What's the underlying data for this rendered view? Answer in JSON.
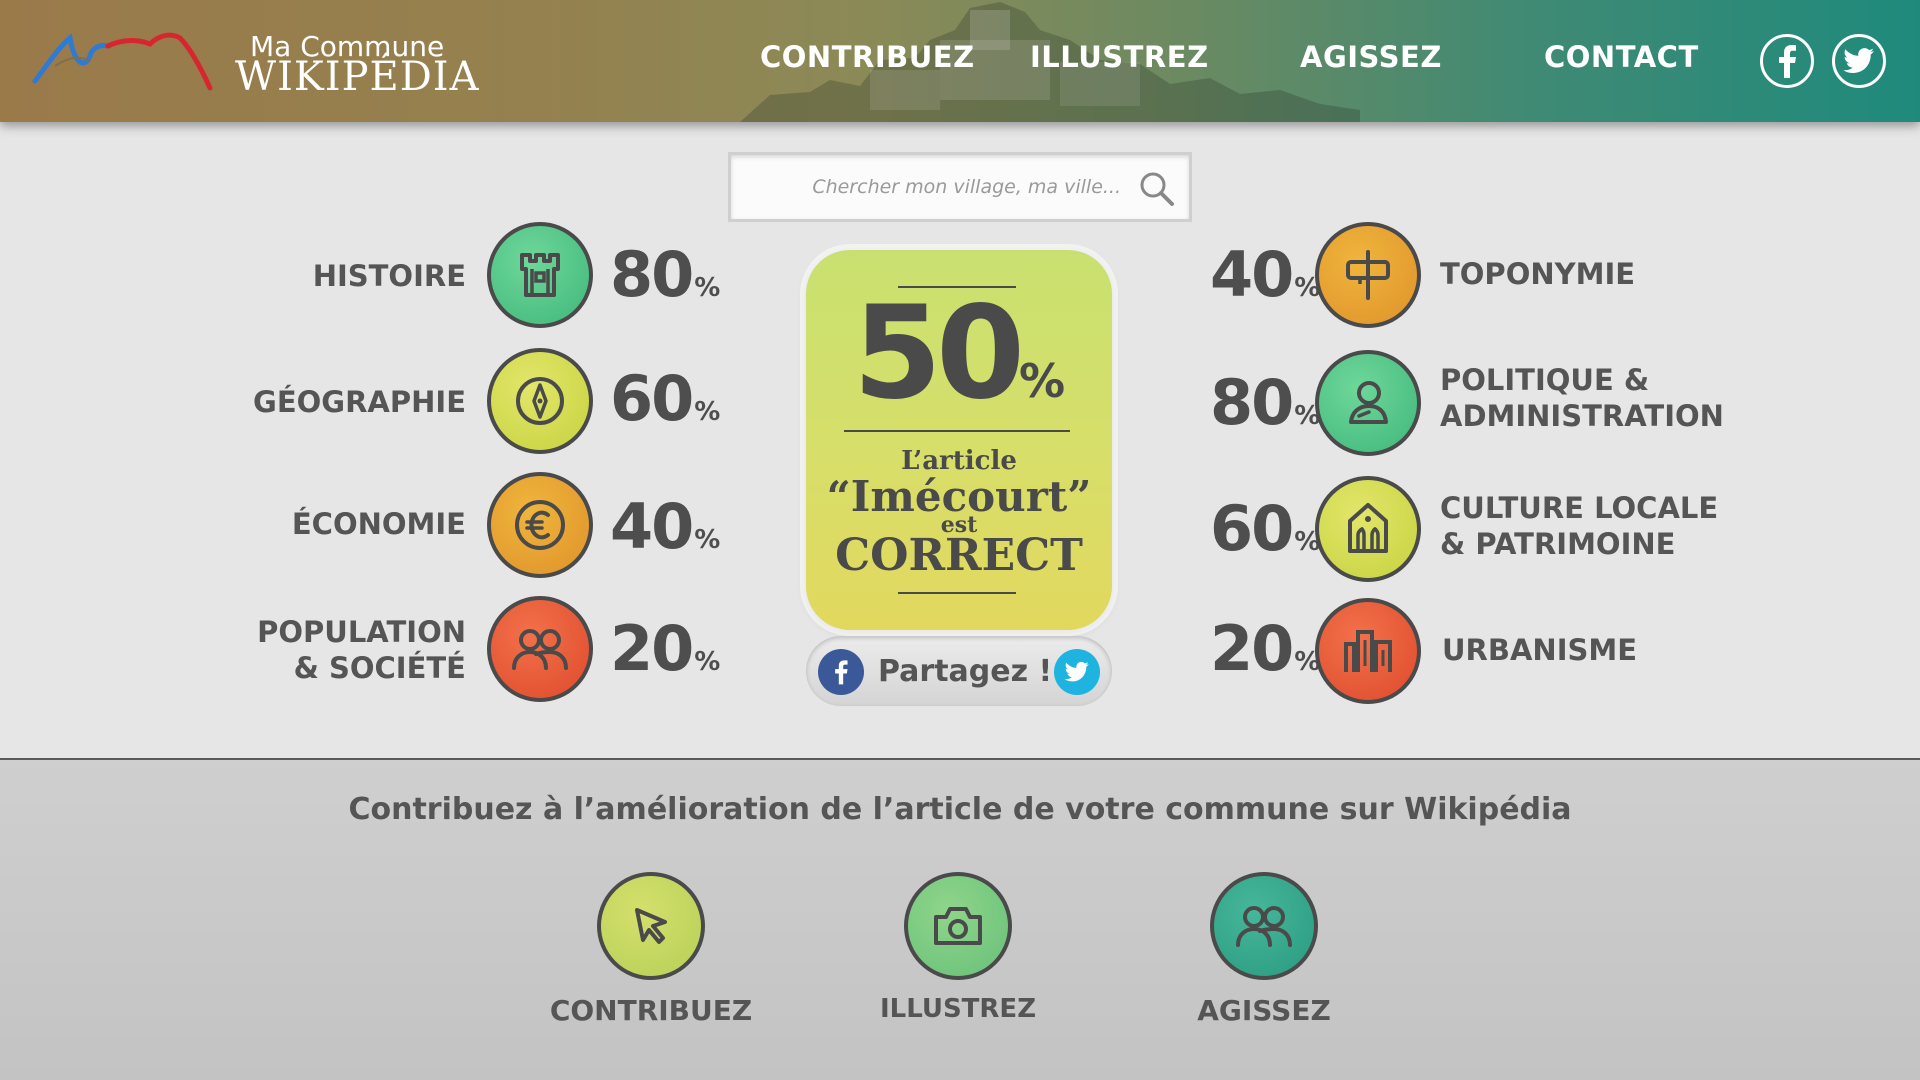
{
  "header": {
    "logo_line1": "Ma Commune",
    "logo_line2": "WIKIPÉDIA",
    "nav": [
      "CONTRIBUEZ",
      "ILLUSTREZ",
      "AGISSEZ",
      "CONTACT"
    ]
  },
  "search": {
    "placeholder": "Chercher mon village, ma ville..."
  },
  "categories_left": [
    {
      "label": "HISTOIRE",
      "value": "80",
      "icon": "castle-icon"
    },
    {
      "label": "GÉOGRAPHIE",
      "value": "60",
      "icon": "compass-icon"
    },
    {
      "label": "ÉCONOMIE",
      "value": "40",
      "icon": "euro-icon"
    },
    {
      "label_lines": [
        "POPULATION",
        "& SOCIÉTÉ"
      ],
      "value": "20",
      "icon": "people-icon"
    }
  ],
  "categories_right": [
    {
      "label": "TOPONYMIE",
      "value": "40",
      "icon": "signpost-icon"
    },
    {
      "label_lines": [
        "POLITIQUE &",
        "ADMINISTRATION"
      ],
      "value": "80",
      "icon": "person-icon"
    },
    {
      "label_lines": [
        "CULTURE LOCALE",
        "& PATRIMOINE"
      ],
      "value": "60",
      "icon": "monument-icon"
    },
    {
      "label": "URBANISME",
      "value": "20",
      "icon": "buildings-icon"
    }
  ],
  "percent_symbol": "%",
  "score": {
    "value": "50",
    "line1": "L’article",
    "line2": "“Imécourt”",
    "line3": "est",
    "line4": "CORRECT"
  },
  "share": {
    "label": "Partagez !"
  },
  "footer": {
    "title": "Contribuez à l’amélioration de l’article de votre commune sur Wikipédia",
    "actions": [
      "CONTRIBUEZ",
      "ILLUSTREZ",
      "AGISSEZ"
    ]
  },
  "colors": {
    "green": "#5cc98a",
    "yellow_green": "#d3db55",
    "orange": "#e6a02e",
    "red": "#e85a36",
    "teal": "#2ea58a"
  }
}
